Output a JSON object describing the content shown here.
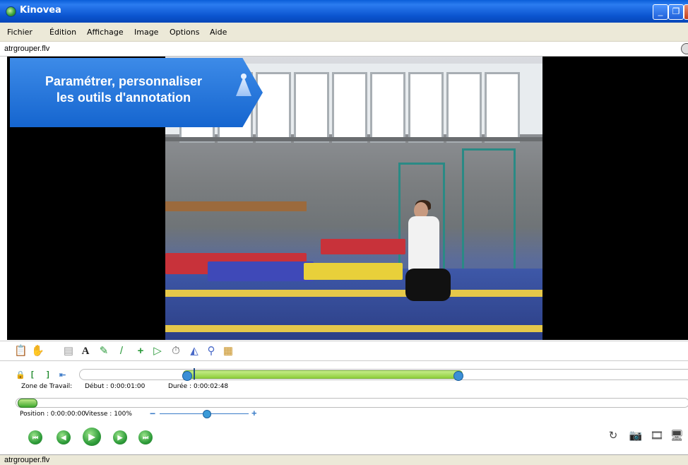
{
  "window": {
    "title": "Kinovea",
    "minimize_glyph": "_",
    "restore_glyph": "❐",
    "close_glyph": "✕"
  },
  "menu": [
    "Fichier",
    "Édition",
    "Affichage",
    "Image",
    "Options",
    "Aide"
  ],
  "file_tab": {
    "name": "atrgrouper.flv"
  },
  "callout": {
    "line1": "Paramétrer, personnaliser",
    "line2": "les outils d'annotation"
  },
  "toolbar": {
    "icons": [
      "new-keyframe-icon",
      "hand-icon",
      "comment-icon",
      "text-icon",
      "pencil-icon",
      "line-icon",
      "cross-icon",
      "angle-icon",
      "chrono-icon",
      "grid-icon",
      "magnifier-icon",
      "color-palette-icon"
    ],
    "glyphs": [
      "📋",
      "✋",
      "▤",
      "A",
      "✎",
      "/",
      "+",
      "▷",
      "⏱",
      "◭",
      "⚲",
      "▦"
    ]
  },
  "working_zone": {
    "label": "Zone de Travail:",
    "start": "Début : 0:00:01:00",
    "duration": "Durée : 0:00:02:48",
    "icon_glyphs": [
      "🔒",
      "[",
      "]",
      "⇤"
    ],
    "start_fraction": 0.168,
    "end_fraction": 0.62
  },
  "position": {
    "label": "Position : 0:00:00:00",
    "speed_label": "Vitesse : 100%",
    "minus": "−",
    "plus": "+",
    "speed_fraction": 0.48
  },
  "playback": {
    "buttons": [
      "⏮",
      "◀",
      "▶",
      "▶",
      "⏭"
    ],
    "right_icons": [
      "↻",
      "📷",
      "🎞",
      "🖥"
    ]
  },
  "status": {
    "text": "atrgrouper.flv"
  },
  "colors": {
    "titlebar": "#0a5ed8",
    "menubar": "#ece9d8",
    "callout": "#1565cf",
    "range": "#8fcf3c",
    "play_green": "#2f9d3a"
  }
}
